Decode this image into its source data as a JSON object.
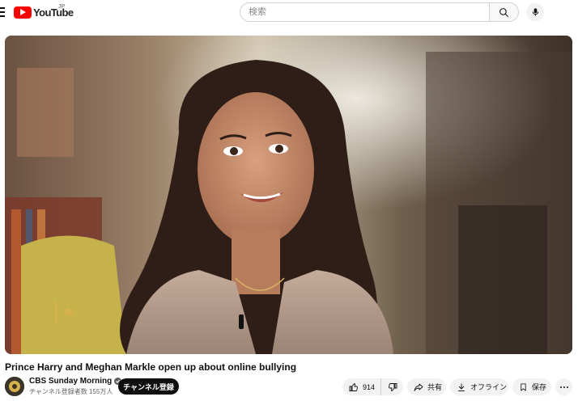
{
  "masthead": {
    "logo_text": "YouTube",
    "country_code": "JP",
    "search_placeholder": "検索",
    "icons": [
      "menu-icon",
      "youtube-logo",
      "search-icon",
      "microphone-icon"
    ]
  },
  "player": {
    "description": "",
    "watermark_icon": "sun-icon",
    "colors": {
      "accent": "#d7b14a"
    }
  },
  "video": {
    "title": "Prince Harry and Meghan Markle open up about online bullying"
  },
  "channel": {
    "name": "CBS Sunday Morning",
    "verified": true,
    "subscribers": "チャンネル登録者数 155万人",
    "subscribe_label": "チャンネル登録"
  },
  "actions": {
    "likes": "914",
    "share_label": "共有",
    "offline_label": "オフライン",
    "save_label": "保存",
    "icons": [
      "thumbs-up-icon",
      "thumbs-down-icon",
      "share-icon",
      "download-icon",
      "bookmark-icon",
      "more-icon"
    ]
  },
  "colors": {
    "brand_red": "#ff0000",
    "subscribe_bg": "#0f0f0f",
    "pill_bg": "#f2f2f2",
    "text_secondary": "#606060"
  }
}
